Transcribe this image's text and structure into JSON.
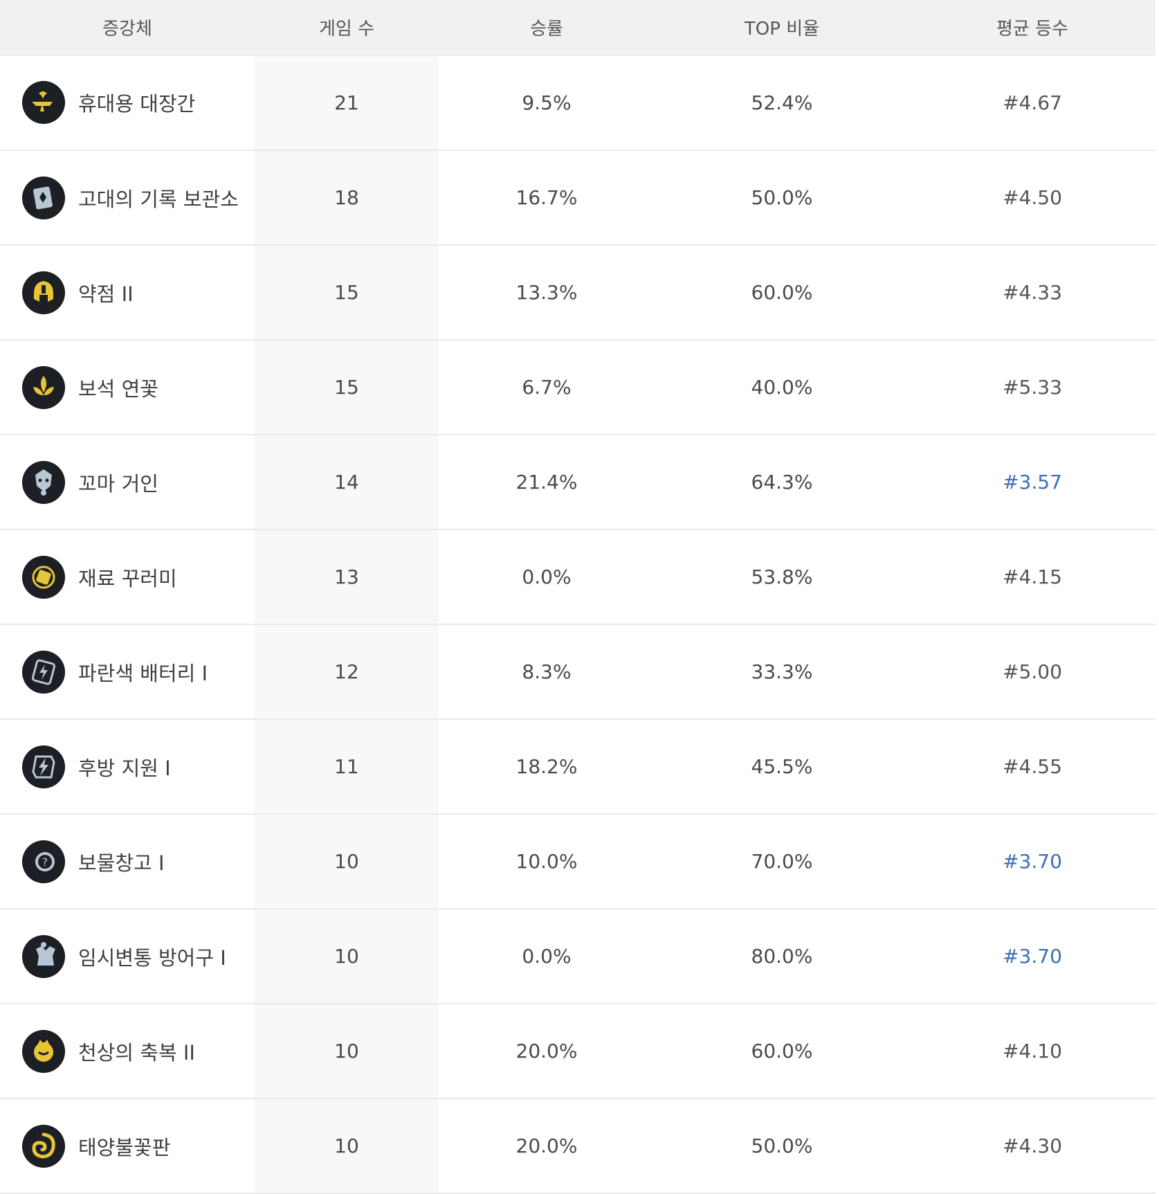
{
  "headers": {
    "augment": "증강체",
    "games": "게임 수",
    "win_rate": "승률",
    "top_rate": "TOP 비율",
    "avg_placement": "평균 등수"
  },
  "colors": {
    "highlight_placement": "#3a6fb8",
    "gold_icon": "#e8c437",
    "silver_icon": "#b8c7d3"
  },
  "rows": [
    {
      "name": "휴대용 대장간",
      "games": "21",
      "win_rate": "9.5%",
      "top_rate": "52.4%",
      "avg_placement": "#4.67",
      "highlight": false,
      "icon": "anvil-icon",
      "tier": "gold"
    },
    {
      "name": "고대의 기록 보관소",
      "games": "18",
      "win_rate": "16.7%",
      "top_rate": "50.0%",
      "avg_placement": "#4.50",
      "highlight": false,
      "icon": "tome-icon",
      "tier": "silver"
    },
    {
      "name": "약점 II",
      "games": "15",
      "win_rate": "13.3%",
      "top_rate": "60.0%",
      "avg_placement": "#4.33",
      "highlight": false,
      "icon": "helmet-icon",
      "tier": "gold"
    },
    {
      "name": "보석 연꽃",
      "games": "15",
      "win_rate": "6.7%",
      "top_rate": "40.0%",
      "avg_placement": "#5.33",
      "highlight": false,
      "icon": "lotus-icon",
      "tier": "gold"
    },
    {
      "name": "꼬마 거인",
      "games": "14",
      "win_rate": "21.4%",
      "top_rate": "64.3%",
      "avg_placement": "#3.57",
      "highlight": true,
      "icon": "giant-icon",
      "tier": "silver"
    },
    {
      "name": "재료 꾸러미",
      "games": "13",
      "win_rate": "0.0%",
      "top_rate": "53.8%",
      "avg_placement": "#4.15",
      "highlight": false,
      "icon": "bundle-icon",
      "tier": "gold"
    },
    {
      "name": "파란색 배터리 I",
      "games": "12",
      "win_rate": "8.3%",
      "top_rate": "33.3%",
      "avg_placement": "#5.00",
      "highlight": false,
      "icon": "battery-icon",
      "tier": "silver"
    },
    {
      "name": "후방 지원 I",
      "games": "11",
      "win_rate": "18.2%",
      "top_rate": "45.5%",
      "avg_placement": "#4.55",
      "highlight": false,
      "icon": "lightning-icon",
      "tier": "silver"
    },
    {
      "name": "보물창고 I",
      "games": "10",
      "win_rate": "10.0%",
      "top_rate": "70.0%",
      "avg_placement": "#3.70",
      "highlight": true,
      "icon": "question-icon",
      "tier": "silver"
    },
    {
      "name": "임시변통 방어구 I",
      "games": "10",
      "win_rate": "0.0%",
      "top_rate": "80.0%",
      "avg_placement": "#3.70",
      "highlight": true,
      "icon": "armor-icon",
      "tier": "silver"
    },
    {
      "name": "천상의 축복 II",
      "games": "10",
      "win_rate": "20.0%",
      "top_rate": "60.0%",
      "avg_placement": "#4.10",
      "highlight": false,
      "icon": "blessing-icon",
      "tier": "gold"
    },
    {
      "name": "태양불꽃판",
      "games": "10",
      "win_rate": "20.0%",
      "top_rate": "50.0%",
      "avg_placement": "#4.30",
      "highlight": false,
      "icon": "sunfire-icon",
      "tier": "gold"
    }
  ]
}
